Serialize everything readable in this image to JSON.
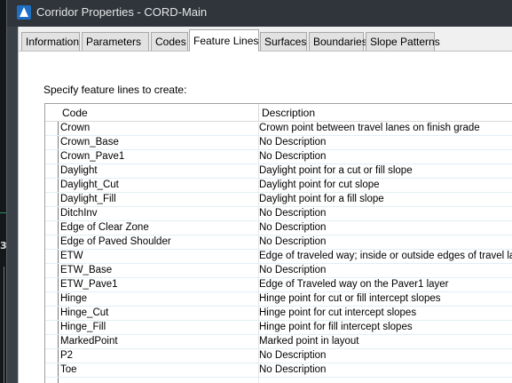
{
  "window": {
    "title": "Corridor Properties - CORD-Main"
  },
  "background": {
    "canvas_text": "3"
  },
  "tabs": [
    {
      "label": "Information",
      "active": false
    },
    {
      "label": "Parameters",
      "active": false
    },
    {
      "label": "Codes",
      "active": false
    },
    {
      "label": "Feature Lines",
      "active": true
    },
    {
      "label": "Surfaces",
      "active": false
    },
    {
      "label": "Boundaries",
      "active": false
    },
    {
      "label": "Slope Patterns",
      "active": false
    }
  ],
  "prompt": "Specify feature lines to create:",
  "table": {
    "columns": {
      "code": "Code",
      "description": "Description"
    },
    "rows": [
      {
        "code": "Crown",
        "description": "Crown point between travel lanes on finish grade"
      },
      {
        "code": "Crown_Base",
        "description": "No Description"
      },
      {
        "code": "Crown_Pave1",
        "description": "No Description"
      },
      {
        "code": "Daylight",
        "description": "Daylight point for a cut or fill slope"
      },
      {
        "code": "Daylight_Cut",
        "description": "Daylight point for cut slope"
      },
      {
        "code": "Daylight_Fill",
        "description": "Daylight point for a fill slope"
      },
      {
        "code": "DitchInv",
        "description": "No Description"
      },
      {
        "code": "Edge of Clear Zone",
        "description": "No Description"
      },
      {
        "code": "Edge of Paved Shoulder",
        "description": "No Description"
      },
      {
        "code": "ETW",
        "description": "Edge of traveled way; inside or outside edges of travel lanes"
      },
      {
        "code": "ETW_Base",
        "description": "No Description"
      },
      {
        "code": "ETW_Pave1",
        "description": "Edge of Traveled way on the Paver1 layer"
      },
      {
        "code": "Hinge",
        "description": "Hinge point for cut or fill intercept slopes"
      },
      {
        "code": "Hinge_Cut",
        "description": "Hinge point for cut intercept slopes"
      },
      {
        "code": "Hinge_Fill",
        "description": "Hinge point for fill intercept slopes"
      },
      {
        "code": "MarkedPoint",
        "description": "Marked point in layout"
      },
      {
        "code": "P2",
        "description": "No Description"
      },
      {
        "code": "Toe",
        "description": "No Description"
      }
    ]
  }
}
